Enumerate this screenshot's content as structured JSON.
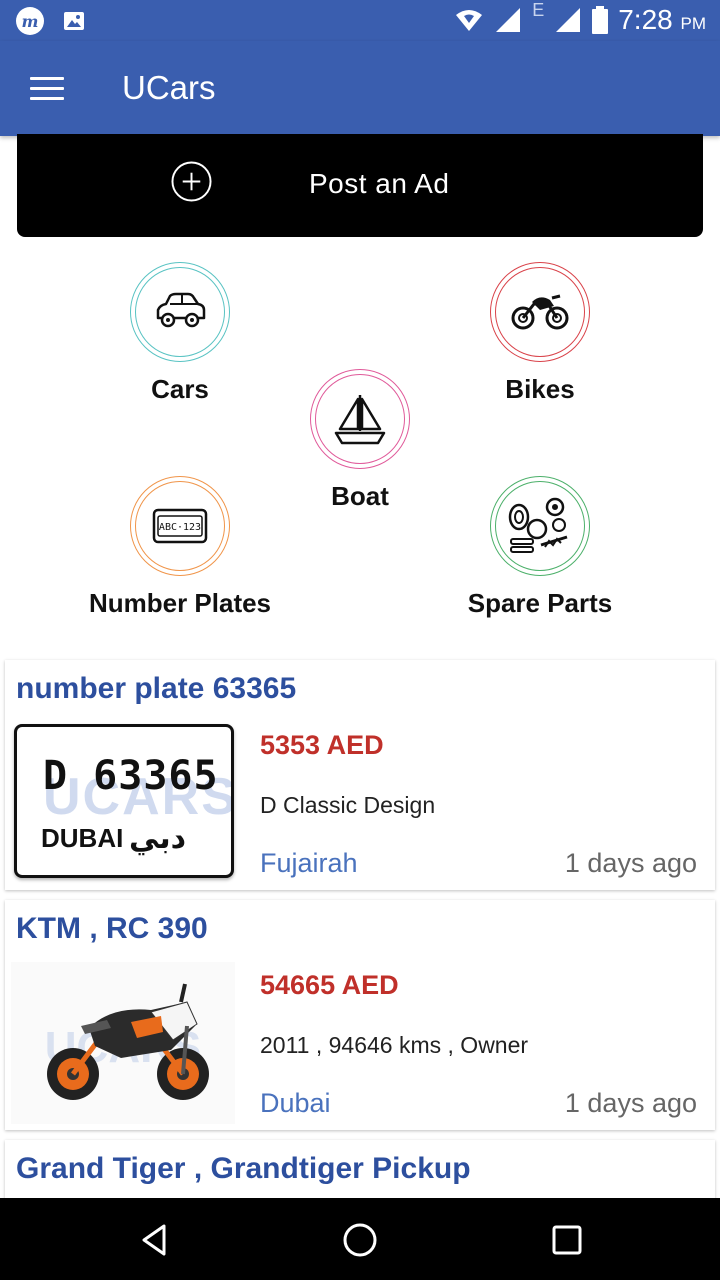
{
  "status_bar": {
    "time": "7:28",
    "ampm": "PM",
    "network_label": "E"
  },
  "app_bar": {
    "title": "UCars"
  },
  "post_ad": {
    "label": "Post an Ad"
  },
  "categories": [
    {
      "label": "Cars",
      "ring_color": "#59c3c3",
      "icon": "car-icon"
    },
    {
      "label": "Bikes",
      "ring_color": "#d9434a",
      "icon": "motorbike-icon"
    },
    {
      "label": "Boat",
      "ring_color": "#e05a9a",
      "icon": "sailboat-icon"
    },
    {
      "label": "Number Plates",
      "ring_color": "#f0954a",
      "icon": "license-plate-icon"
    },
    {
      "label": "Spare Parts",
      "ring_color": "#4cb06a",
      "icon": "spare-parts-icon"
    }
  ],
  "listings": [
    {
      "title": "number plate 63365",
      "price": "5353 AED",
      "description": "D Classic Design",
      "location": "Fujairah",
      "age": "1 days ago",
      "plate": {
        "number": "D  63365",
        "city": "DUBAI",
        "arabic": "دبي",
        "watermark": "UCARS"
      }
    },
    {
      "title": "KTM , RC 390",
      "price": "54665 AED",
      "description": "2011 , 94646 kms , Owner",
      "location": "Dubai",
      "age": "1 days ago"
    },
    {
      "title": "Grand Tiger , Grandtiger Pickup"
    }
  ],
  "colors": {
    "primary": "#3a5eaf",
    "title_blue": "#2d4f9e",
    "price_red": "#c0302a",
    "location_blue": "#4a72bd"
  }
}
